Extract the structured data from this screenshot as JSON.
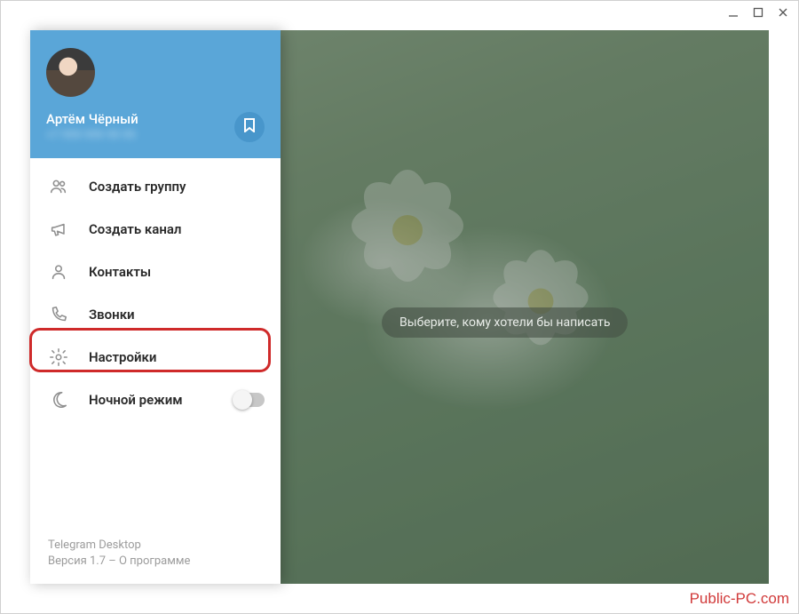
{
  "user": {
    "name": "Артём Чёрный",
    "phone": "+7 999 999 99 99"
  },
  "menu": {
    "new_group": "Создать группу",
    "new_channel": "Создать канал",
    "contacts": "Контакты",
    "calls": "Звонки",
    "settings": "Настройки",
    "night_mode": "Ночной режим"
  },
  "footer": {
    "app": "Telegram Desktop",
    "version": "Версия 1.7 – О программе"
  },
  "chat": {
    "placeholder": "Выберите, кому хотели бы написать"
  },
  "watermark": "Public-PC.com"
}
